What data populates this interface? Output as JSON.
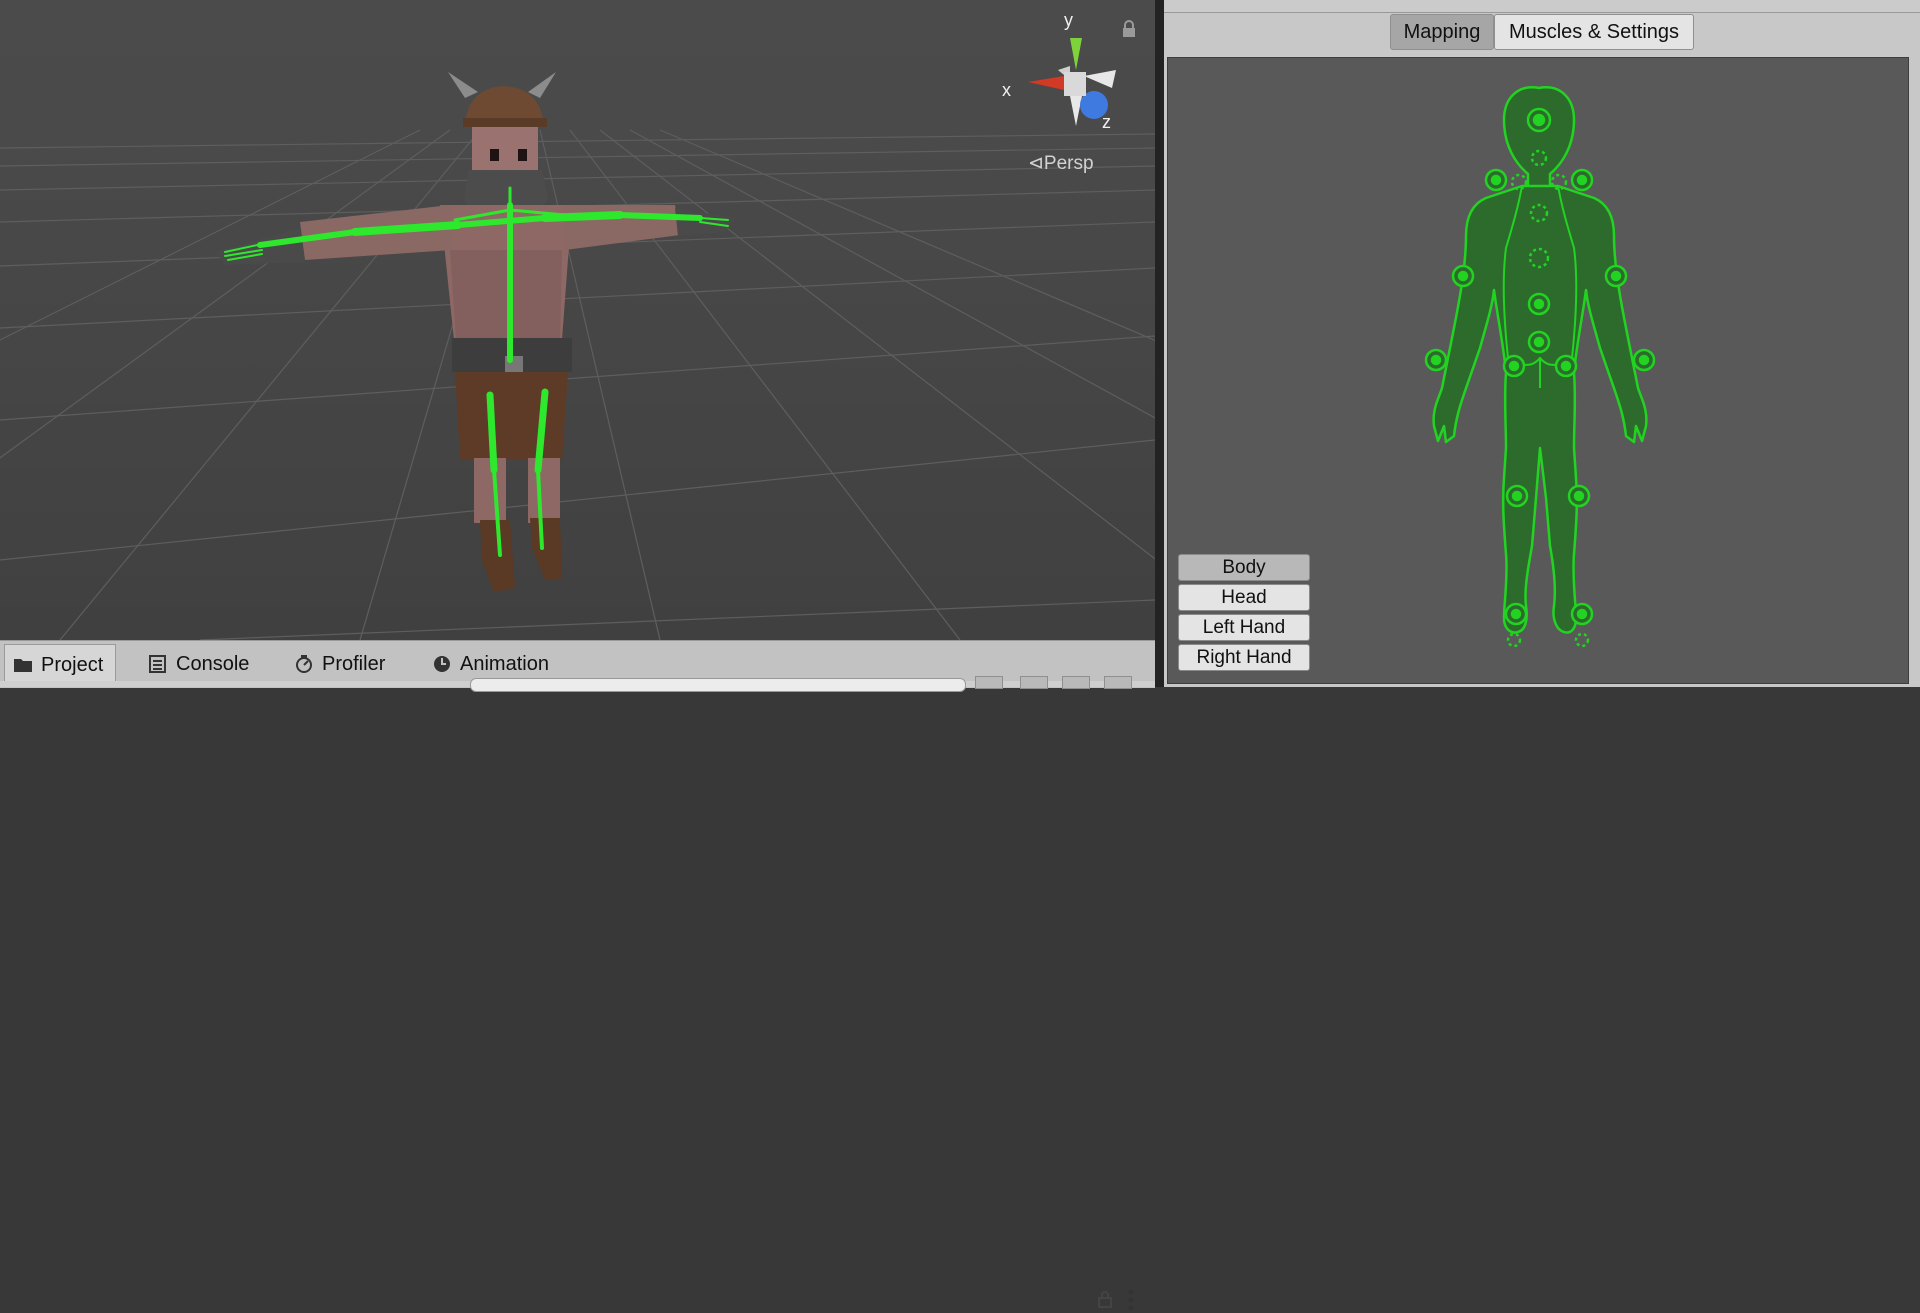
{
  "scene": {
    "gizmo": {
      "x_label": "x",
      "y_label": "y",
      "z_label": "z"
    },
    "persp_label": "⊲Persp"
  },
  "inspector": {
    "tabs": [
      {
        "label": "Mapping",
        "active": true
      },
      {
        "label": "Muscles & Settings",
        "active": false
      }
    ],
    "body_parts": [
      {
        "label": "Body",
        "active": true
      },
      {
        "label": "Head",
        "active": false
      },
      {
        "label": "Left Hand",
        "active": false
      },
      {
        "label": "Right Hand",
        "active": false
      }
    ],
    "avatar_color": "#22d322"
  },
  "bottom_tabs": [
    {
      "label": "Project",
      "icon": "folder-icon",
      "active": true
    },
    {
      "label": "Console",
      "icon": "console-icon",
      "active": false
    },
    {
      "label": "Profiler",
      "icon": "profiler-icon",
      "active": false
    },
    {
      "label": "Animation",
      "icon": "animation-icon",
      "active": false
    }
  ]
}
